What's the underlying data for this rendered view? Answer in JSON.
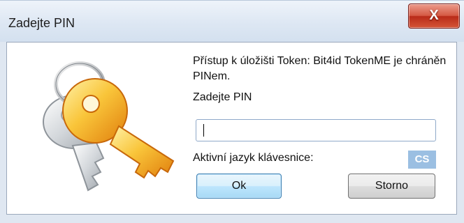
{
  "window": {
    "title": "Zadejte PIN",
    "close_label": "X"
  },
  "dialog": {
    "message": "Přístup k úložišti Token: Bit4id TokenME je chráněn PINem.",
    "pin_label": "Zadejte PIN",
    "pin_value": "",
    "keyboard_label": "Aktivní jazyk klávesnice:",
    "keyboard_lang": "CS",
    "ok_label": "Ok",
    "cancel_label": "Storno"
  },
  "colors": {
    "gold_key": "#f2a81d",
    "silver_key": "#bfc4c9",
    "lang_badge": "#9bbfe2",
    "close_button": "#c9432c"
  },
  "icons": [
    "keys-icon",
    "close-icon"
  ]
}
